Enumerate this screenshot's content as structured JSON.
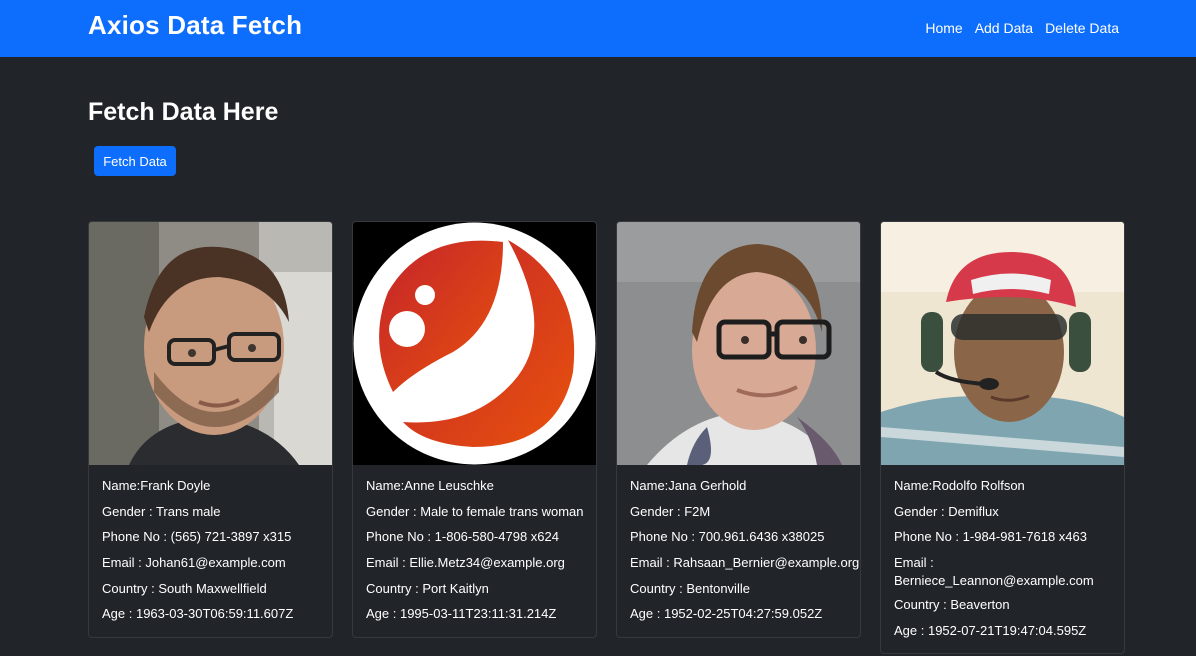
{
  "navbar": {
    "brand": "Axios Data Fetch",
    "links": [
      "Home",
      "Add Data",
      "Delete Data"
    ]
  },
  "main": {
    "title": "Fetch Data Here",
    "fetch_button": "Fetch Data"
  },
  "users": [
    {
      "name": "Name:Frank Doyle",
      "gender": "Gender : Trans male",
      "phone": "Phone No : (565) 721-3897 x315",
      "email": "Email : Johan61@example.com",
      "country": "Country : South Maxwellfield",
      "age": "Age : 1963-03-30T06:59:11.607Z"
    },
    {
      "name": "Name:Anne Leuschke",
      "gender": "Gender : Male to female trans woman",
      "phone": "Phone No : 1-806-580-4798 x624",
      "email": "Email : Ellie.Metz34@example.org",
      "country": "Country : Port Kaitlyn",
      "age": "Age : 1995-03-11T23:11:31.214Z"
    },
    {
      "name": "Name:Jana Gerhold",
      "gender": "Gender : F2M",
      "phone": "Phone No : 700.961.6436 x38025",
      "email": "Email : Rahsaan_Bernier@example.org",
      "country": "Country : Bentonville",
      "age": "Age : 1952-02-25T04:27:59.052Z"
    },
    {
      "name": "Name:Rodolfo Rolfson",
      "gender": "Gender : Demiflux",
      "phone": "Phone No : 1-984-981-7618 x463",
      "email": "Email : Berniece_Leannon@example.com",
      "country": "Country : Beaverton",
      "age": "Age : 1952-07-21T19:47:04.595Z"
    }
  ]
}
